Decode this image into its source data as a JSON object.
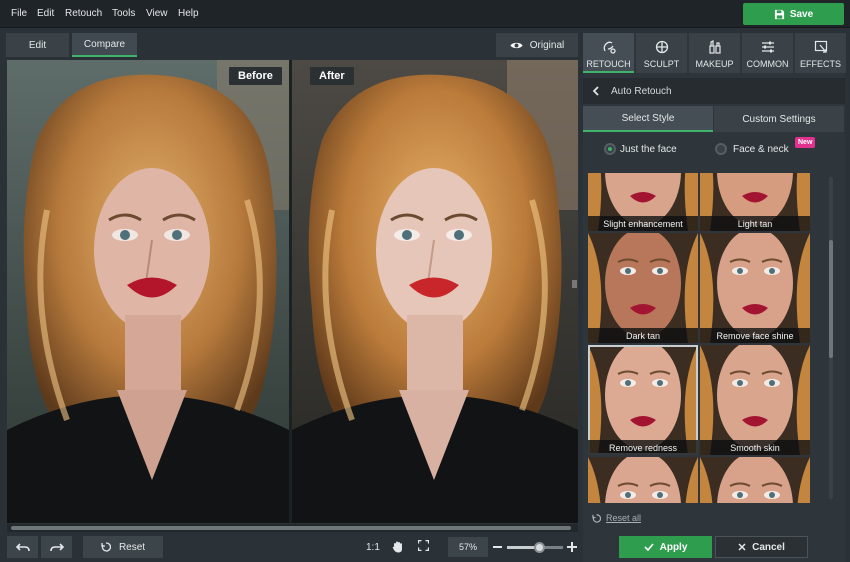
{
  "menu": [
    "File",
    "Edit",
    "Retouch",
    "Tools",
    "View",
    "Help"
  ],
  "save_label": "Save",
  "editor": {
    "tabs": [
      "Edit",
      "Compare"
    ],
    "active_tab": "Compare",
    "original_label": "Original",
    "before_label": "Before",
    "after_label": "After"
  },
  "bottom": {
    "reset_label": "Reset",
    "one_to_one": "1:1",
    "zoom_value": "57%",
    "zoom_level": 0.57
  },
  "tools": [
    {
      "label": "RETOUCH",
      "icon": "retouch-icon",
      "active": true
    },
    {
      "label": "SCULPT",
      "icon": "sculpt-icon",
      "active": false
    },
    {
      "label": "MAKEUP",
      "icon": "makeup-icon",
      "active": false
    },
    {
      "label": "COMMON",
      "icon": "sliders-icon",
      "active": false
    },
    {
      "label": "EFFECTS",
      "icon": "effects-icon",
      "active": false
    }
  ],
  "panel": {
    "header": "Auto Retouch",
    "style_tabs": [
      "Select Style",
      "Custom Settings"
    ],
    "radio_face": "Just the face",
    "radio_neck": "Face & neck",
    "new_badge": "New",
    "presets": [
      {
        "label": "Slight enhancement",
        "tone": "#d8a48c",
        "selected": false
      },
      {
        "label": "Light tan",
        "tone": "#d69c7f",
        "selected": false
      },
      {
        "label": "Dark tan",
        "tone": "#b8775a",
        "selected": false
      },
      {
        "label": "Remove face shine",
        "tone": "#d7a289",
        "selected": false
      },
      {
        "label": "Remove redness",
        "tone": "#dcaa93",
        "selected": true
      },
      {
        "label": "Smooth skin",
        "tone": "#d9a58d",
        "selected": false
      },
      {
        "label": "",
        "tone": "#dba690",
        "selected": false
      },
      {
        "label": "",
        "tone": "#d8a28a",
        "selected": false
      }
    ],
    "reset_all": "Reset all",
    "apply_label": "Apply",
    "cancel_label": "Cancel"
  },
  "colors": {
    "accent": "#2f9d4e",
    "new_badge": "#e0318f",
    "lips_before": "#b3152b",
    "lips_after": "#c8262b"
  }
}
